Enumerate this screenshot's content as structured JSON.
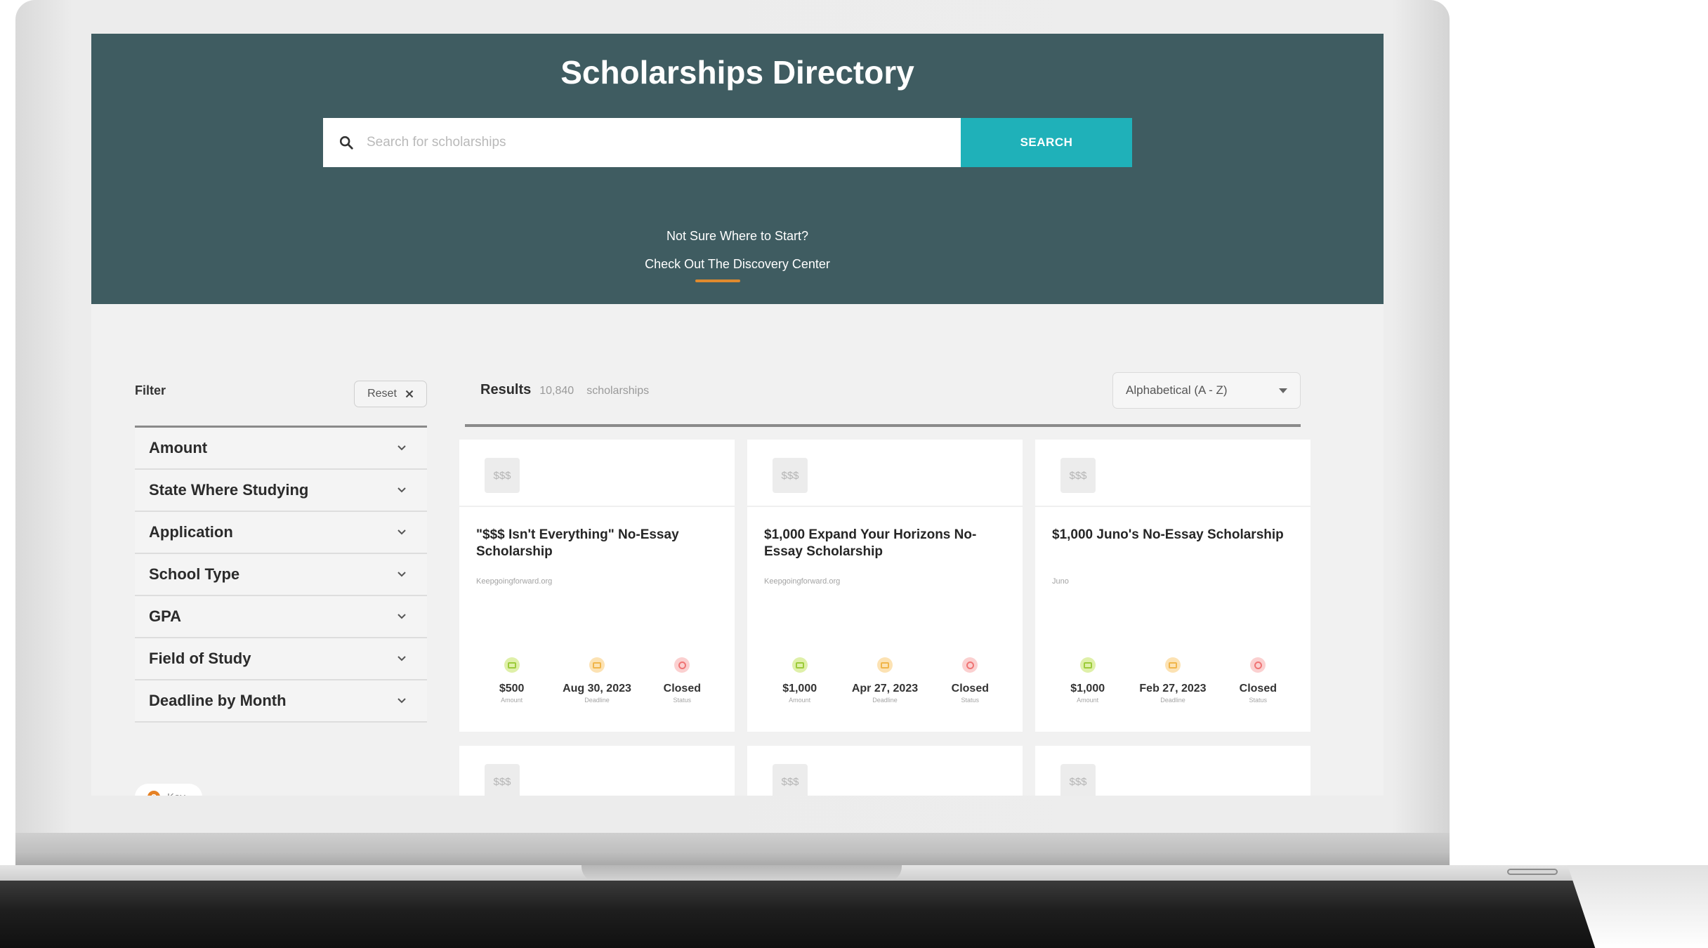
{
  "header": {
    "title": "Scholarships Directory",
    "search_placeholder": "Search for scholarships",
    "search_button": "SEARCH",
    "discover_question": "Not Sure Where to Start?",
    "discover_link": "Check Out The Discovery Center"
  },
  "filters": {
    "label": "Filter",
    "reset": "Reset",
    "items": [
      "Amount",
      "State Where Studying",
      "Application",
      "School Type",
      "GPA",
      "Field of Study",
      "Deadline by Month"
    ],
    "key": "Key"
  },
  "results": {
    "label": "Results",
    "count": "10,840",
    "unit": "scholarships",
    "sort": "Alphabetical (A - Z)",
    "badge": "$$$",
    "stat_labels": {
      "amount": "Amount",
      "deadline": "Deadline",
      "status": "Status"
    },
    "cards": [
      {
        "title": "\"$$$ Isn't Everything\" No-Essay Scholarship",
        "provider": "Keepgoingforward.org",
        "amount": "$500",
        "deadline": "Aug 30, 2023",
        "status": "Closed"
      },
      {
        "title": "$1,000 Expand Your Horizons No-Essay Scholarship",
        "provider": "Keepgoingforward.org",
        "amount": "$1,000",
        "deadline": "Apr 27, 2023",
        "status": "Closed"
      },
      {
        "title": "$1,000 Juno's No-Essay Scholarship",
        "provider": "Juno",
        "amount": "$1,000",
        "deadline": "Feb 27, 2023",
        "status": "Closed"
      }
    ]
  },
  "colors": {
    "header_bg": "#3f5c61",
    "search_button": "#1fb1b9",
    "accent_underline": "#e08a2e"
  }
}
